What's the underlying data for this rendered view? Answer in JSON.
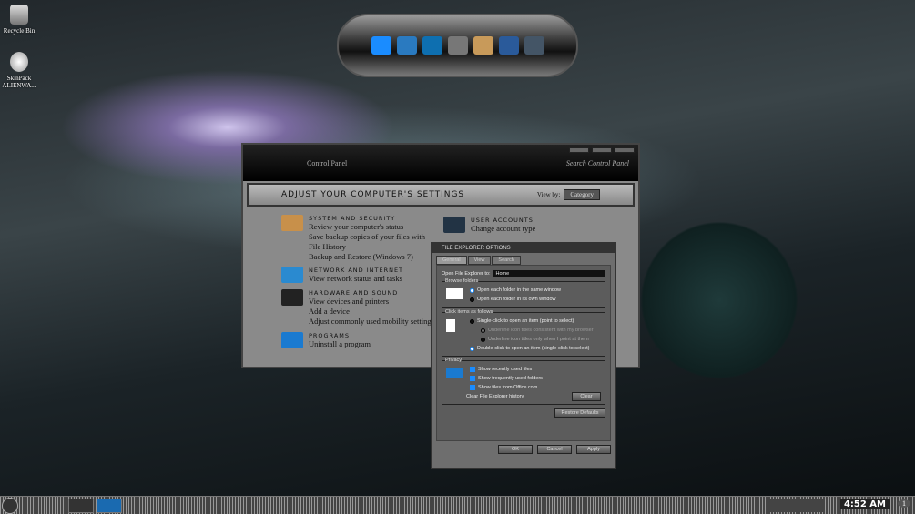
{
  "desktop": {
    "icons": [
      {
        "label": "Recycle Bin",
        "icon": "recycle-bin-icon"
      },
      {
        "label": "SkinPack ALIENWA...",
        "icon": "alien-icon"
      }
    ]
  },
  "control_panel": {
    "breadcrumb": "Control Panel",
    "search_placeholder": "Search Control Panel",
    "heading": "ADJUST YOUR COMPUTER'S SETTINGS",
    "view_by_label": "View by:",
    "view_by_value": "Category",
    "categories": [
      {
        "title": "SYSTEM AND SECURITY",
        "links": [
          "Review your computer's status",
          "Save backup copies of your files with File History",
          "Backup and Restore (Windows 7)"
        ]
      },
      {
        "title": "NETWORK AND INTERNET",
        "links": [
          "View network status and tasks"
        ]
      },
      {
        "title": "HARDWARE AND SOUND",
        "links": [
          "View devices and printers",
          "Add a device",
          "Adjust commonly used mobility settings"
        ]
      },
      {
        "title": "PROGRAMS",
        "links": [
          "Uninstall a program"
        ]
      },
      {
        "title": "USER ACCOUNTS",
        "links": [
          "Change account type"
        ]
      }
    ]
  },
  "folder_options": {
    "title": "FILE EXPLORER OPTIONS",
    "tabs": [
      "General",
      "View",
      "Search"
    ],
    "open_to_label": "Open File Explorer to:",
    "open_to_value": "Home",
    "browse": {
      "label": "Browse folders",
      "options": [
        "Open each folder in the same window",
        "Open each folder in its own window"
      ]
    },
    "click": {
      "label": "Click items as follows",
      "options": [
        "Single-click to open an item (point to select)",
        "Underline icon titles consistent with my browser",
        "Underline icon titles only when I point at them",
        "Double-click to open an item (single-click to select)"
      ]
    },
    "privacy": {
      "label": "Privacy",
      "checks": [
        "Show recently used files",
        "Show frequently used folders",
        "Show files from Office.com"
      ],
      "clear_label": "Clear File Explorer history",
      "clear_button": "Clear"
    },
    "restore_button": "Restore Defaults",
    "ok": "OK",
    "cancel": "Cancel",
    "apply": "Apply"
  },
  "taskbar": {
    "clock": "4:52 AM",
    "notification_count": "1"
  },
  "colors": {
    "accent": "#1a8cff"
  }
}
